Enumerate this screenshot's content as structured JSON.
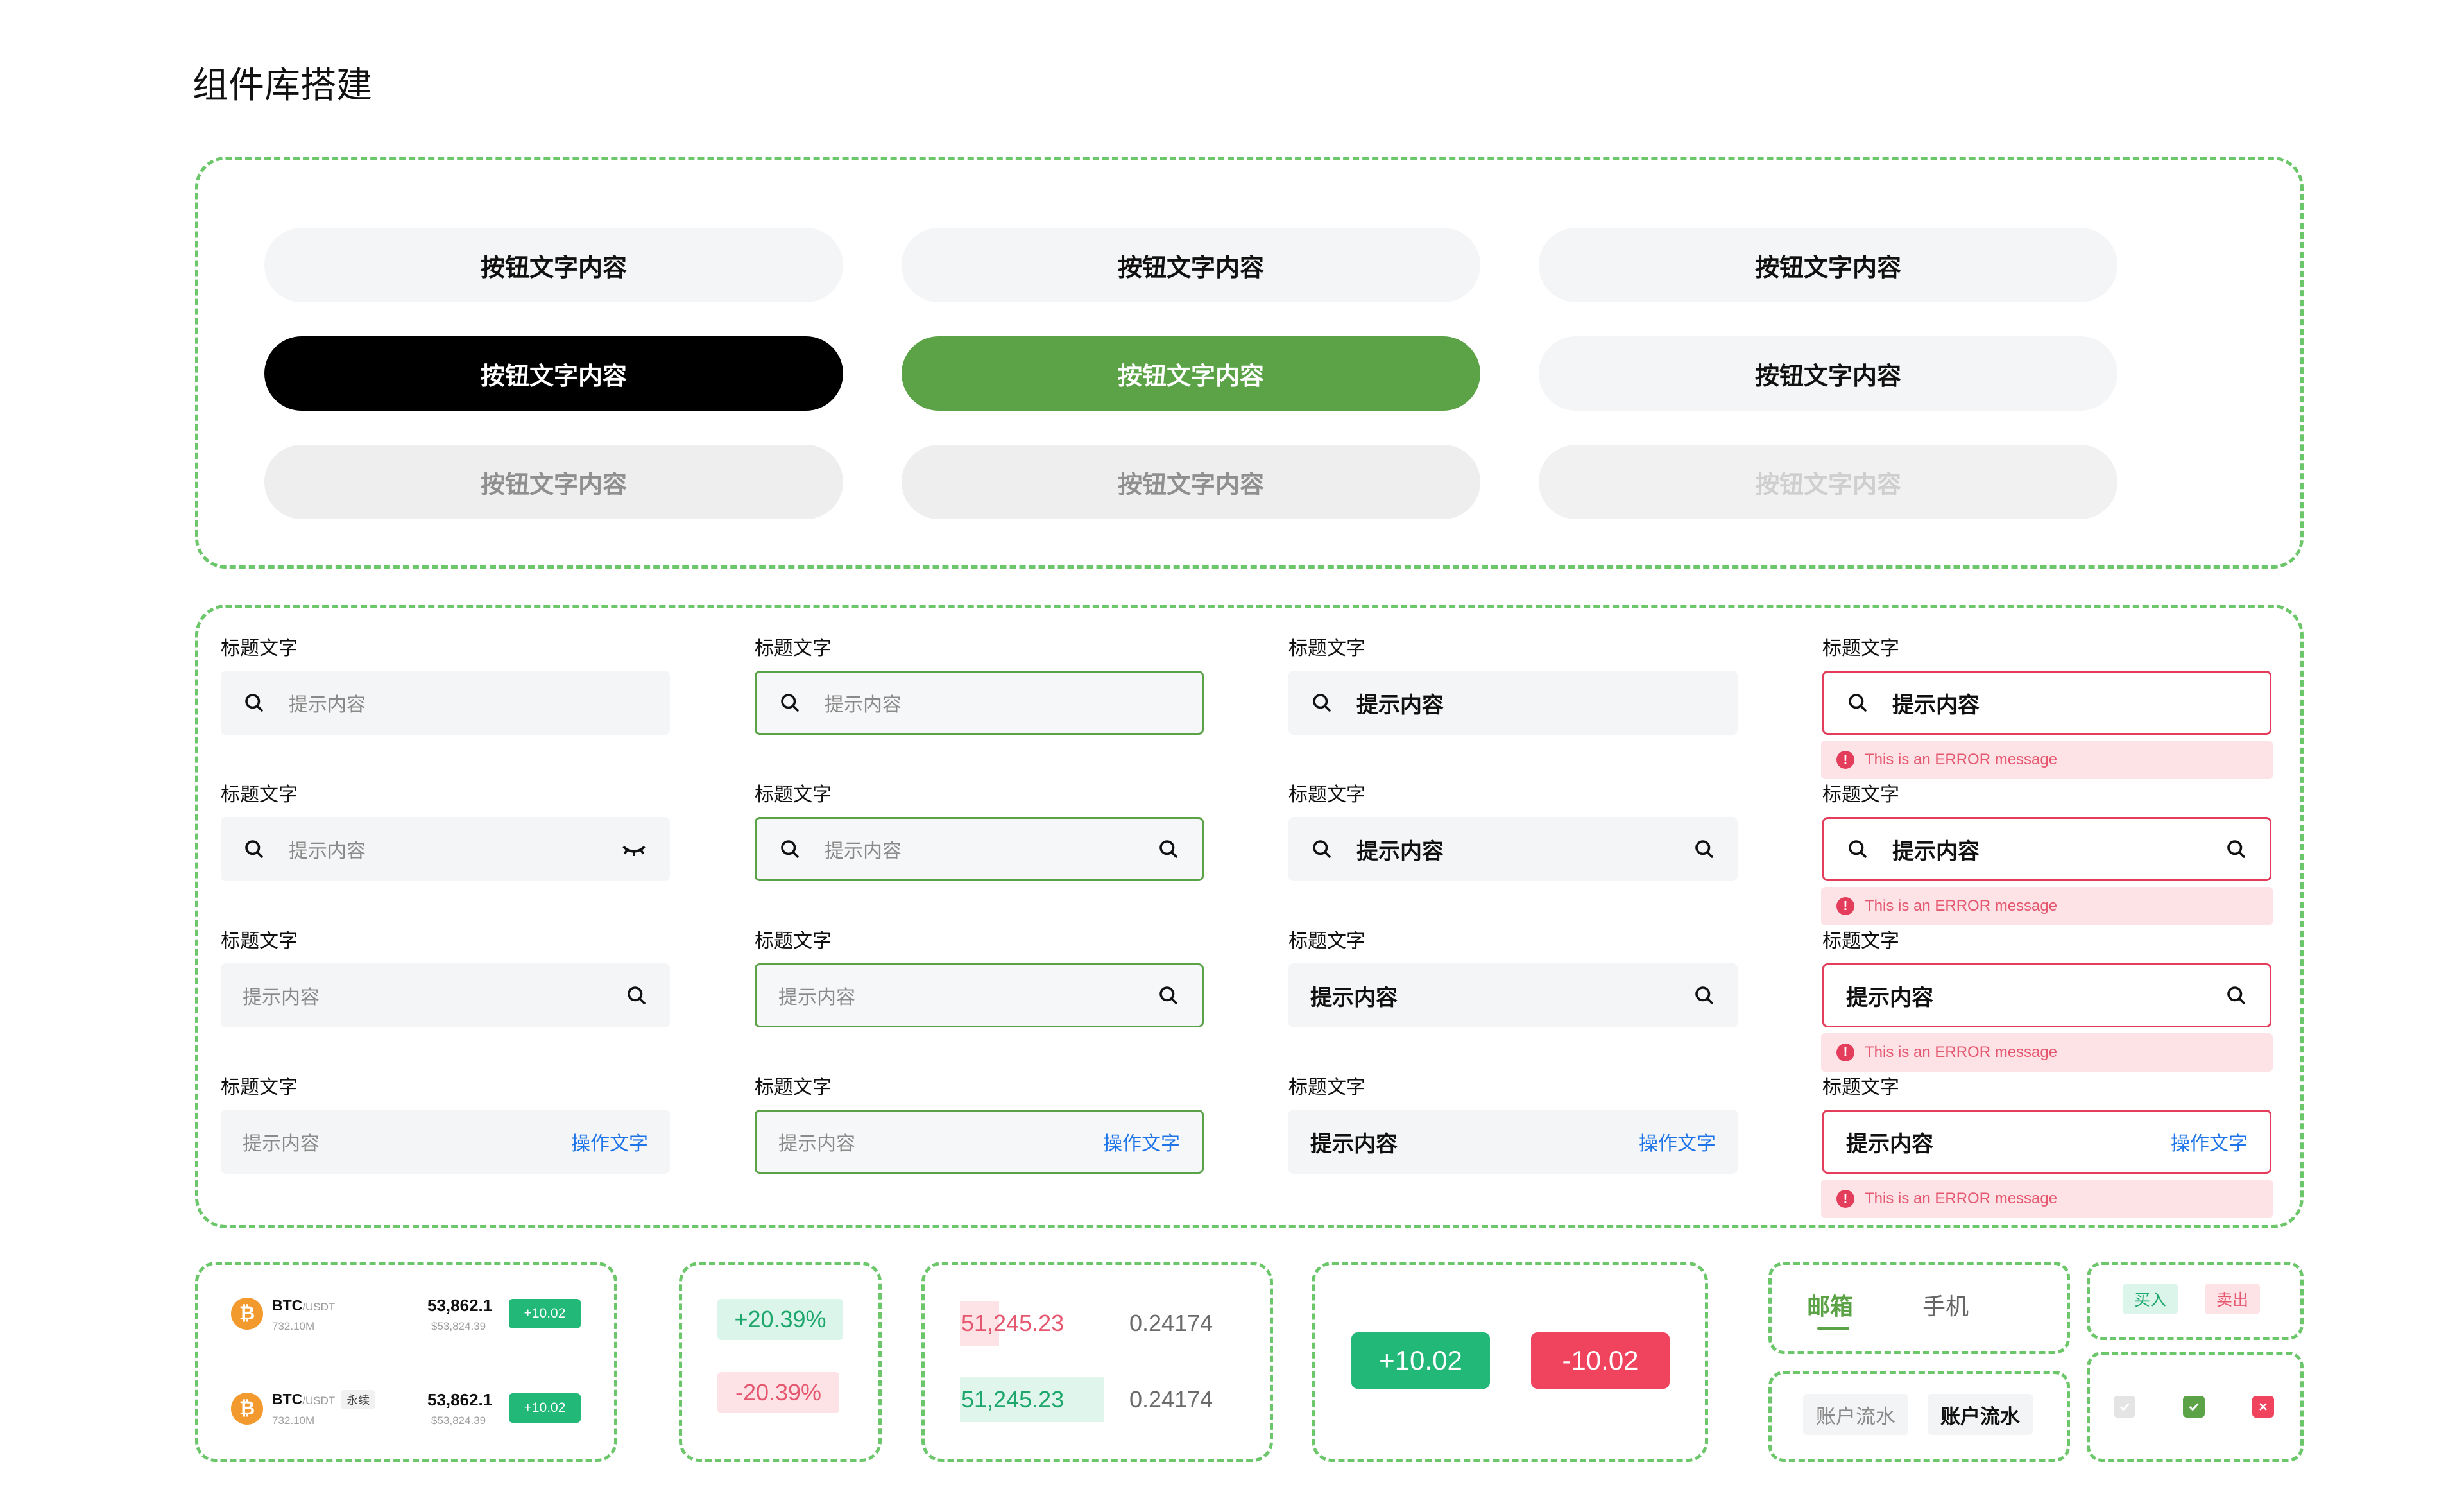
{
  "page": {
    "title": "组件库搭建"
  },
  "buttons": {
    "label": "按钮文字内容",
    "variants": [
      "default",
      "default",
      "default",
      "primary-black",
      "primary-green",
      "default",
      "disabled",
      "disabled",
      "disabled-light"
    ]
  },
  "fields": {
    "title": "标题文字",
    "placeholder": "提示内容",
    "filled_value": "提示内容",
    "action": "操作文字",
    "error": "This is an ERROR message"
  },
  "tickers": {
    "rows": [
      {
        "symbol": "BTC",
        "quote": "/USDT",
        "tag": "",
        "volume": "732.10M",
        "price": "53,862.1",
        "price_fiat": "$53,824.39",
        "change": "+10.02"
      },
      {
        "symbol": "BTC",
        "quote": "/USDT",
        "tag": "永续",
        "volume": "732.10M",
        "price": "53,862.1",
        "price_fiat": "$53,824.39",
        "change": "+10.02"
      }
    ]
  },
  "percent_badges": {
    "up": "+20.39%",
    "down": "-20.39%"
  },
  "orderbook": {
    "rows": [
      {
        "price": "51,245.23",
        "qty": "0.24174",
        "side": "sell",
        "depth": 0.15
      },
      {
        "price": "51,245.23",
        "qty": "0.24174",
        "side": "buy",
        "depth": 0.55
      }
    ]
  },
  "change_badges": {
    "up": "+10.02",
    "down": "-10.02"
  },
  "tabs": {
    "items": [
      "邮箱",
      "手机"
    ],
    "active": 0
  },
  "chips": {
    "items": [
      "账户流水",
      "账户流水"
    ]
  },
  "trade_tags": {
    "buy": "买入",
    "sell": "卖出"
  },
  "colors": {
    "accent_green": "#5ba346",
    "up_green": "#22b878",
    "down_red": "#f0435e",
    "error_red": "#e33d5b",
    "link_blue": "#1d74e8",
    "dashed_border": "#6cc66a"
  }
}
